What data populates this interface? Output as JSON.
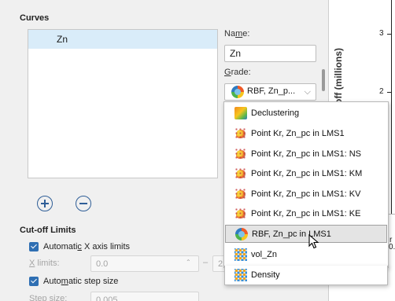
{
  "curves": {
    "section_title": "Curves",
    "items": [
      "Zn"
    ],
    "add_icon": "plus-circle-icon",
    "remove_icon": "minus-circle-icon"
  },
  "name_field": {
    "label_prefix": "Na",
    "label_mnemonic": "m",
    "label_suffix": "e:",
    "value": "Zn"
  },
  "grade_field": {
    "label_mnemonic": "G",
    "label_suffix": "rade:",
    "selected": "RBF, Zn_p...",
    "options": [
      {
        "label": "Declustering",
        "icon": "grid-declustering-icon"
      },
      {
        "label": "Point Kr, Zn_pc in LMS1",
        "icon": "point-kriging-icon"
      },
      {
        "label": "Point Kr, Zn_pc in LMS1: NS",
        "icon": "point-kriging-icon"
      },
      {
        "label": "Point Kr, Zn_pc in LMS1: KM",
        "icon": "point-kriging-icon"
      },
      {
        "label": "Point Kr, Zn_pc in LMS1: KV",
        "icon": "point-kriging-icon"
      },
      {
        "label": "Point Kr, Zn_pc in LMS1: KE",
        "icon": "point-kriging-icon"
      },
      {
        "label": "RBF, Zn_pc in LMS1",
        "icon": "rbf-icon"
      },
      {
        "label": "vol_Zn",
        "icon": "volume-points-icon"
      },
      {
        "label": "Density",
        "icon": "volume-points-icon"
      }
    ]
  },
  "cutoff": {
    "section_title": "Cut-off Limits",
    "auto_x_label_prefix": "Automati",
    "auto_x_label_mnemonic": "c",
    "auto_x_label_suffix": " X axis limits",
    "x_limits_mnemonic": "X",
    "x_limits_suffix": " limits:",
    "x_min": "0.0",
    "separator": "–",
    "x_max_partial": "2",
    "auto_step_prefix": "Auto",
    "auto_step_mnemonic": "m",
    "auto_step_suffix": "atic step size",
    "step_label_partial": "Step size:",
    "step_value_partial": "0.005"
  },
  "plot": {
    "y_axis_title": "ove cut-off (millions)",
    "y_ticks": [
      "3",
      "2"
    ],
    "x_tick_partial": "0.0",
    "x_label_partial": "r"
  }
}
